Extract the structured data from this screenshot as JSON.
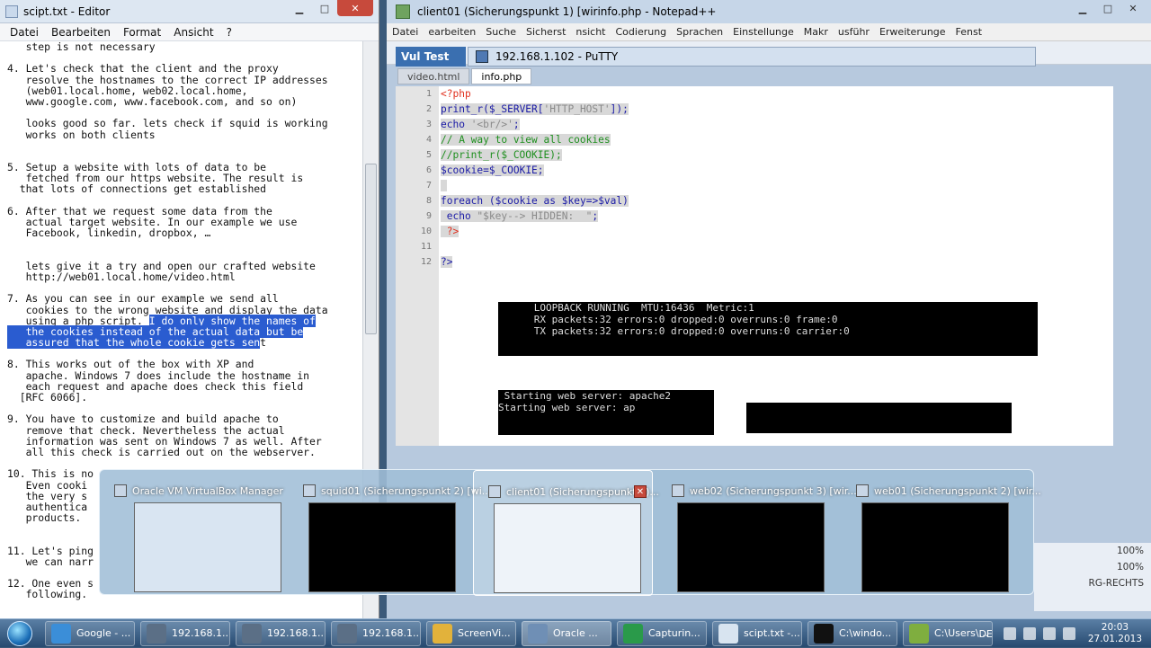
{
  "editor": {
    "title": "scipt.txt - Editor",
    "menu": [
      "Datei",
      "Bearbeiten",
      "Format",
      "Ansicht",
      "?"
    ],
    "lines": [
      {
        "t": "   step is not necessary"
      },
      {
        "t": ""
      },
      {
        "t": "4. Let's check that the client and the proxy"
      },
      {
        "t": "   resolve the hostnames to the correct IP addresses"
      },
      {
        "t": "   (web01.local.home, web02.local.home,"
      },
      {
        "t": "   www.google.com, www.facebook.com, and so on)"
      },
      {
        "t": ""
      },
      {
        "t": "   looks good so far. lets check if squid is working"
      },
      {
        "t": "   works on both clients"
      },
      {
        "t": ""
      },
      {
        "t": ""
      },
      {
        "t": "5. Setup a website with lots of data to be"
      },
      {
        "t": "   fetched from our https website. The result is"
      },
      {
        "t": "  that lots of connections get established"
      },
      {
        "t": ""
      },
      {
        "t": "6. After that we request some data from the"
      },
      {
        "t": "   actual target website. In our example we use"
      },
      {
        "t": "   Facebook, linkedin, dropbox, …"
      },
      {
        "t": ""
      },
      {
        "t": ""
      },
      {
        "t": "   lets give it a try and open our crafted website"
      },
      {
        "t": "   http://web01.local.home/video.html"
      },
      {
        "t": ""
      },
      {
        "t": "7. As you can see in our example we send all"
      },
      {
        "t": "   cookies to the wrong website and display the data"
      },
      {
        "t": "   using a php script. ",
        "h": "I do only show the names of"
      },
      {
        "t": "",
        "h": "   the cookies instead of the actual data but be"
      },
      {
        "t": "",
        "h": "   assured that the whole cookie gets sen",
        "a": "t"
      },
      {
        "t": ""
      },
      {
        "t": "8. This works out of the box with XP and"
      },
      {
        "t": "   apache. Windows 7 does include the hostname in"
      },
      {
        "t": "   each request and apache does check this field"
      },
      {
        "t": "  [RFC 6066]."
      },
      {
        "t": ""
      },
      {
        "t": "9. You have to customize and build apache to"
      },
      {
        "t": "   remove that check. Nevertheless the actual"
      },
      {
        "t": "   information was sent on Windows 7 as well. After"
      },
      {
        "t": "   all this check is carried out on the webserver."
      },
      {
        "t": ""
      },
      {
        "t": "10. This is no"
      },
      {
        "t": "   Even cooki"
      },
      {
        "t": "   the very s"
      },
      {
        "t": "   authentica"
      },
      {
        "t": "   products."
      },
      {
        "t": ""
      },
      {
        "t": ""
      },
      {
        "t": "11. Let's ping"
      },
      {
        "t": "   we can narr"
      },
      {
        "t": ""
      },
      {
        "t": "12. One even s"
      },
      {
        "t": "   following."
      }
    ]
  },
  "npp": {
    "title": "client01 (Sicherungspunkt 1) [wirinfo.php - Notepad++",
    "menu": [
      "Datei",
      "earbeiten",
      "Suche",
      "Sicherst",
      "nsicht",
      "Codierung",
      "Sprachen",
      "Einstellunge",
      "Makr",
      "usführ",
      "Erweiterunge",
      "Fenst"
    ],
    "tabs": [
      "video.html",
      "info.php"
    ],
    "gutter": [
      "1",
      "2",
      "3",
      "4",
      "5",
      "6",
      "7",
      "8",
      "9",
      "10",
      "11",
      "12"
    ],
    "code": [
      {
        "parts": [
          [
            "c-php",
            "<?php"
          ]
        ]
      },
      {
        "parts": [
          [
            "c-kw",
            "print_r("
          ],
          [
            "c-var",
            "$_SERVER"
          ],
          [
            "c-kw",
            "["
          ],
          [
            "c-str",
            "'HTTP_HOST'"
          ],
          [
            "c-kw",
            "]);"
          ]
        ],
        "sel": true
      },
      {
        "parts": [
          [
            "c-kw",
            "echo "
          ],
          [
            "c-str",
            "'<br/>'"
          ],
          [
            "c-kw",
            ";"
          ]
        ],
        "sel": true
      },
      {
        "parts": [
          [
            "c-cmt",
            "// A way to view all cookies"
          ]
        ],
        "sel": true
      },
      {
        "parts": [
          [
            "c-cmt",
            "//print_r($_COOKIE);"
          ]
        ],
        "sel": true
      },
      {
        "parts": [
          [
            "c-var",
            "$cookie"
          ],
          [
            "c-kw",
            "="
          ],
          [
            "c-var",
            "$_COOKIE"
          ],
          [
            "c-kw",
            ";"
          ]
        ],
        "sel": true
      },
      {
        "parts": [
          [
            "c-kw",
            " "
          ]
        ],
        "sel": true
      },
      {
        "parts": [
          [
            "c-kw",
            "foreach "
          ],
          [
            "c-kw",
            "("
          ],
          [
            "c-var",
            "$cookie"
          ],
          [
            "c-kw",
            " as "
          ],
          [
            "c-var",
            "$key"
          ],
          [
            "c-kw",
            "=>"
          ],
          [
            "c-var",
            "$val"
          ],
          [
            "c-kw",
            ")"
          ]
        ],
        "sel": true
      },
      {
        "parts": [
          [
            "c-kw",
            " echo "
          ],
          [
            "c-str",
            "\"$key--> HIDDEN:  \""
          ],
          [
            "c-kw",
            ";"
          ]
        ],
        "sel": true
      },
      {
        "parts": [
          [
            "c-php",
            " ?>"
          ]
        ],
        "sel": true
      },
      {
        "parts": [
          [
            "c-kw",
            ""
          ]
        ],
        "sel": true
      },
      {
        "parts": [
          [
            "c-kw",
            "?>"
          ]
        ],
        "sel": true
      }
    ],
    "status": [
      "100%",
      "100%",
      "RG-RECHTS"
    ]
  },
  "putty": {
    "title": "192.168.1.102 - PuTTY",
    "vul": "Vul Test"
  },
  "terminal": {
    "lines": [
      "      LOOPBACK RUNNING  MTU:16436  Metric:1",
      "      RX packets:32 errors:0 dropped:0 overruns:0 frame:0",
      "      TX packets:32 errors:0 dropped:0 overruns:0 carrier:0"
    ],
    "lines2": [
      " Starting web server: apache2",
      "Starting web server: ap"
    ]
  },
  "thumbnails": [
    {
      "title": "Oracle VM VirtualBox Manager",
      "color": "#d9e5f2",
      "icon": "virtualbox-icon"
    },
    {
      "title": "squid01 (Sicherungspunkt 2) [wi...",
      "color": "#000000",
      "icon": "vm-icon"
    },
    {
      "title": "client01 (Sicherungspunkt 1)...",
      "color": "#eef3f9",
      "icon": "vm-icon",
      "active": true
    },
    {
      "title": "web02 (Sicherungspunkt 3) [wir...",
      "color": "#000000",
      "icon": "vm-icon"
    },
    {
      "title": "web01 (Sicherungspunkt 2) [wir...",
      "color": "#000000",
      "icon": "vm-icon"
    }
  ],
  "taskbar": {
    "buttons": [
      {
        "label": "Google - ...",
        "color": "#3b8ed8",
        "icon": "ie-icon"
      },
      {
        "label": "192.168.1...",
        "color": "#5b6f86",
        "icon": "putty-icon"
      },
      {
        "label": "192.168.1...",
        "color": "#5b6f86",
        "icon": "putty-icon"
      },
      {
        "label": "192.168.1...",
        "color": "#5b6f86",
        "icon": "putty-icon"
      },
      {
        "label": "ScreenVi...",
        "color": "#e2b23b",
        "icon": "folder-icon"
      },
      {
        "label": "Oracle ...",
        "color": "#6f8fb5",
        "icon": "virtualbox-icon",
        "active": true
      },
      {
        "label": "Capturin...",
        "color": "#2a9a4a",
        "icon": "capture-icon"
      },
      {
        "label": "scipt.txt -...",
        "color": "#d8e4f0",
        "icon": "notepad-icon"
      },
      {
        "label": "C:\\windo...",
        "color": "#111111",
        "icon": "cmd-icon"
      },
      {
        "label": "C:\\Users\\...",
        "color": "#7fae3f",
        "icon": "notepadpp-icon"
      }
    ],
    "tray_lang": "DE",
    "time": "20:03",
    "date": "27.01.2013"
  }
}
